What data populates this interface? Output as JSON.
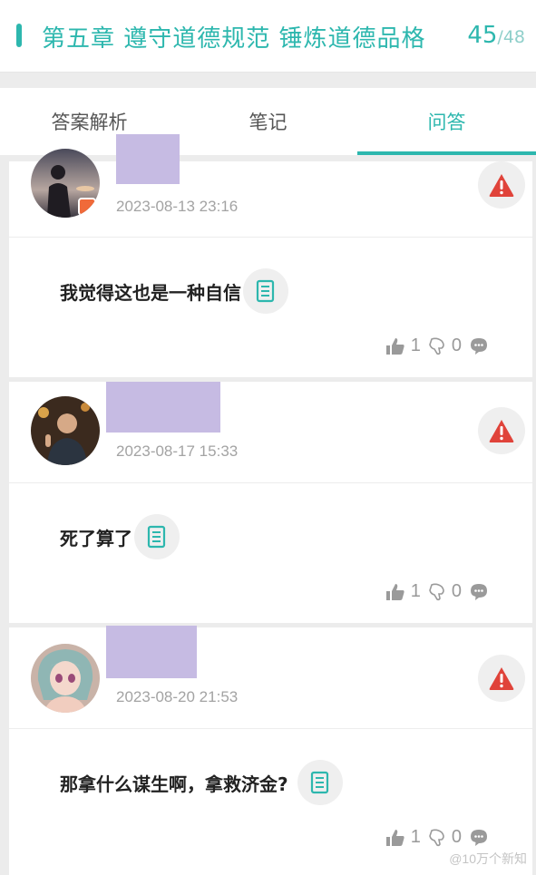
{
  "header": {
    "title": "第五章 遵守道德规范 锤炼道德品格",
    "current": "45",
    "total": "/48"
  },
  "tabs": [
    {
      "label": "答案解析",
      "active": false
    },
    {
      "label": "笔记",
      "active": false
    },
    {
      "label": "问答",
      "active": true
    }
  ],
  "posts": [
    {
      "time": "2023-08-13 23:16",
      "answer": "我觉得这也是一种自信",
      "likes": "1",
      "comments": "0"
    },
    {
      "time": "2023-08-17 15:33",
      "answer": "死了算了",
      "likes": "1",
      "comments": "0"
    },
    {
      "time": "2023-08-20 21:53",
      "answer": "那拿什么谋生啊，拿救济金?",
      "likes": "1",
      "comments": "0"
    }
  ],
  "colors": {
    "accent": "#2db7ae",
    "warning": "#e0433a",
    "redaction": "#c6bbe3"
  },
  "watermark": "@10万个新知"
}
